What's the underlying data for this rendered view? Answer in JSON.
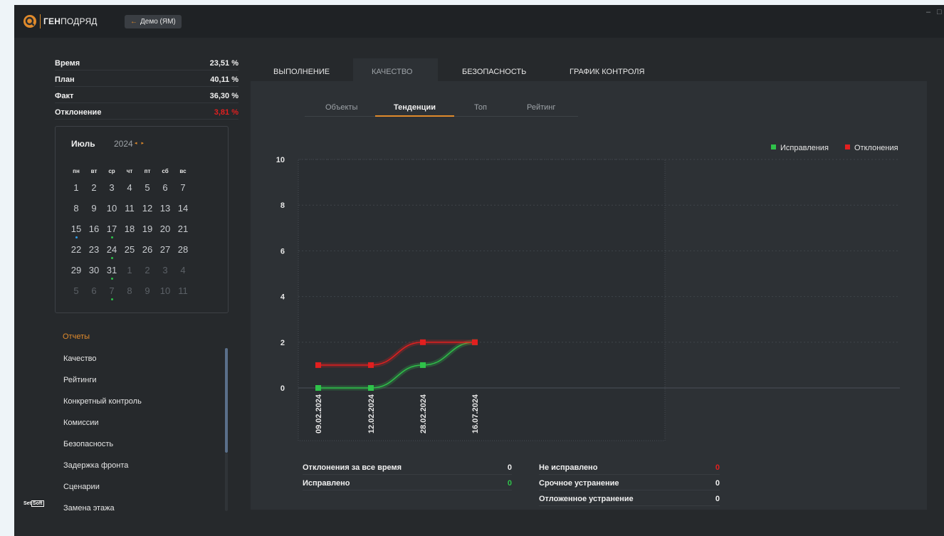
{
  "app": {
    "logo_bold": "ГЕН",
    "logo_rest": "ПОДРЯД",
    "back_button": "Демо (ЯМ)",
    "brand_text": "Set",
    "brand_box": "Soft"
  },
  "stats": [
    {
      "label": "Время",
      "value": "23,51 %"
    },
    {
      "label": "План",
      "value": "40,11 %"
    },
    {
      "label": "Факт",
      "value": "36,30 %"
    },
    {
      "label": "Отклонение",
      "value": "3,81 %"
    }
  ],
  "calendar": {
    "month": "Июль",
    "year": "2024",
    "arrows": "◂ ▸",
    "weekdays": [
      "пн",
      "вт",
      "ср",
      "чт",
      "пт",
      "сб",
      "вс"
    ],
    "weeks": [
      [
        "1",
        "2",
        "3",
        "4",
        "5",
        "6",
        "7"
      ],
      [
        "8",
        "9",
        "10",
        "11",
        "12",
        "13",
        "14"
      ],
      [
        "15",
        "16",
        "17",
        "18",
        "19",
        "20",
        "21"
      ],
      [
        "22",
        "23",
        "24",
        "25",
        "26",
        "27",
        "28"
      ],
      [
        "29",
        "30",
        "31",
        "1",
        "2",
        "3",
        "4"
      ],
      [
        "5",
        "6",
        "7",
        "8",
        "9",
        "10",
        "11"
      ]
    ],
    "marked_days": [
      {
        "week": 2,
        "col": 0,
        "color": "#2f9de8"
      },
      {
        "week": 2,
        "col": 2,
        "color": "#2fc24a"
      },
      {
        "week": 3,
        "col": 2,
        "color": "#2fc24a"
      },
      {
        "week": 4,
        "col": 2,
        "color": "#2fc24a"
      },
      {
        "week": 5,
        "col": 2,
        "color": "#2fc24a"
      }
    ]
  },
  "reports": {
    "title": "Отчеты",
    "items": [
      "Качество",
      "Рейтинги",
      "Конкретный контроль",
      "Комиссии",
      "Безопасность",
      "Задержка фронта",
      "Сценарии",
      "Замена этажа"
    ]
  },
  "tabs": [
    "ВЫПОЛНЕНИЕ",
    "КАЧЕСТВО",
    "БЕЗОПАСНОСТЬ",
    "ГРАФИК КОНТРОЛЯ"
  ],
  "active_tab": "КАЧЕСТВО",
  "subtabs": [
    "Объекты",
    "Тенденции",
    "Топ",
    "Рейтинг"
  ],
  "active_subtab": "Тенденции",
  "colors": {
    "accent": "#e08a2b",
    "green": "#2fc24a",
    "red": "#e21f1f"
  },
  "chart_data": {
    "type": "line",
    "categories": [
      "09.02.2024",
      "12.02.2024",
      "28.02.2024",
      "16.07.2024"
    ],
    "series": [
      {
        "name": "Исправления",
        "color": "#2fc24a",
        "values": [
          0,
          0,
          1,
          2
        ]
      },
      {
        "name": "Отклонения",
        "color": "#e21f1f",
        "values": [
          1,
          1,
          2,
          2
        ]
      }
    ],
    "ylim": [
      0,
      10
    ],
    "yticks": [
      "0",
      "2",
      "4",
      "6",
      "8",
      "10"
    ],
    "legend": "top-right",
    "grid": true
  },
  "summary": {
    "left": [
      {
        "label": "Отклонения за все время",
        "value": "0",
        "color": "#f0f0f0"
      },
      {
        "label": "Исправлено",
        "value": "0",
        "color": "#2fc24a"
      }
    ],
    "right": [
      {
        "label": "Не исправлено",
        "value": "0",
        "color": "#e21f1f"
      },
      {
        "label": "Срочное устранение",
        "value": "0",
        "color": "#f0f0f0"
      },
      {
        "label": "Отложенное устранение",
        "value": "0",
        "color": "#f0f0f0"
      }
    ]
  }
}
